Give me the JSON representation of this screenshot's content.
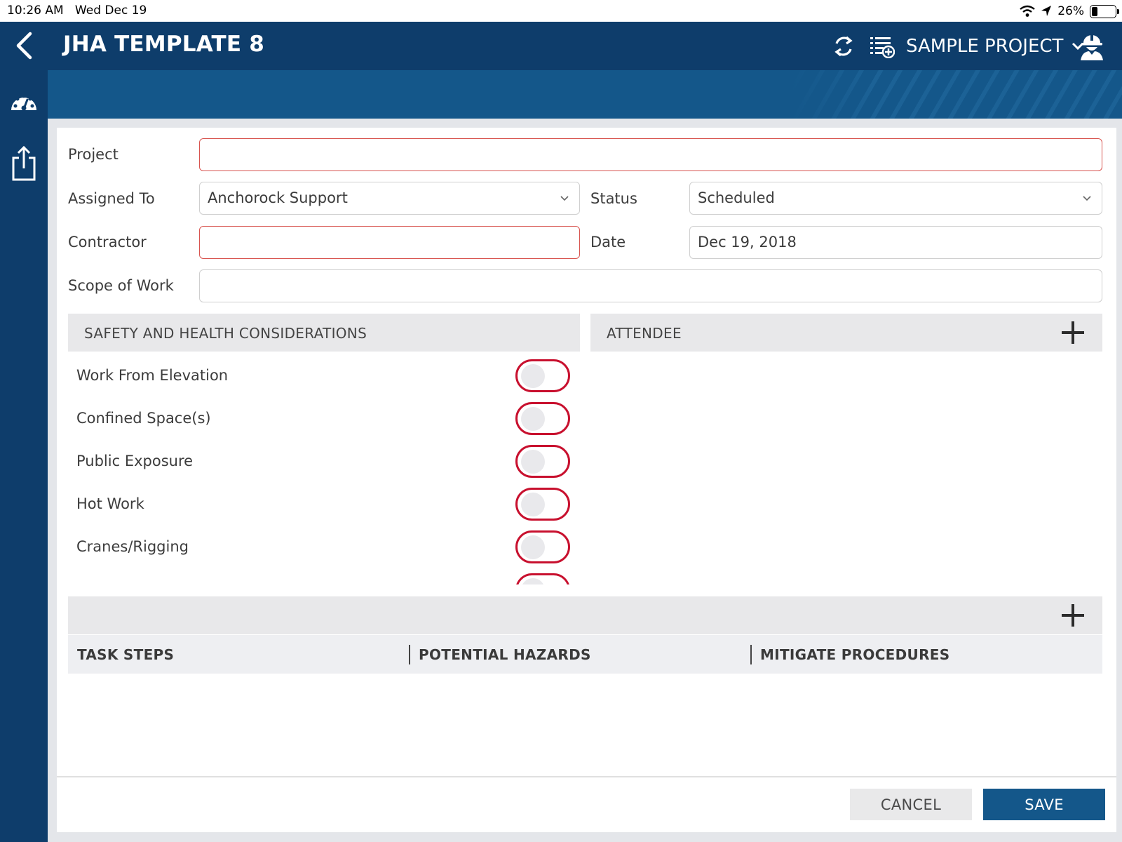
{
  "status_bar": {
    "time": "10:26 AM",
    "date": "Wed Dec 19",
    "battery": "26%",
    "battery_level": 0.26
  },
  "header": {
    "title": "JHA TEMPLATE 8",
    "project_selector": "SAMPLE PROJECT"
  },
  "form": {
    "project": {
      "label": "Project",
      "value": ""
    },
    "assigned_to": {
      "label": "Assigned To",
      "value": "Anchorock Support"
    },
    "status": {
      "label": "Status",
      "value": "Scheduled"
    },
    "contractor": {
      "label": "Contractor",
      "value": ""
    },
    "date": {
      "label": "Date",
      "value": "Dec 19, 2018"
    },
    "scope_of_work": {
      "label": "Scope of Work",
      "value": ""
    }
  },
  "safety": {
    "title": "SAFETY AND HEALTH CONSIDERATIONS",
    "items": [
      {
        "label": "Work From Elevation",
        "on": false
      },
      {
        "label": "Confined Space(s)",
        "on": false
      },
      {
        "label": "Public Exposure",
        "on": false
      },
      {
        "label": "Hot Work",
        "on": false
      },
      {
        "label": "Cranes/Rigging",
        "on": false
      },
      {
        "label": "",
        "on": false
      }
    ]
  },
  "attendee": {
    "title": "ATTENDEE"
  },
  "task_table": {
    "columns": [
      "TASK STEPS",
      "POTENTIAL HAZARDS",
      "MITIGATE PROCEDURES"
    ]
  },
  "footer": {
    "cancel_label": "CANCEL",
    "save_label": "SAVE"
  },
  "colors": {
    "nav_dark": "#0e3d6b",
    "nav_light": "#14578a",
    "required_border": "#d8544f",
    "toggle_border": "#c8102e"
  }
}
